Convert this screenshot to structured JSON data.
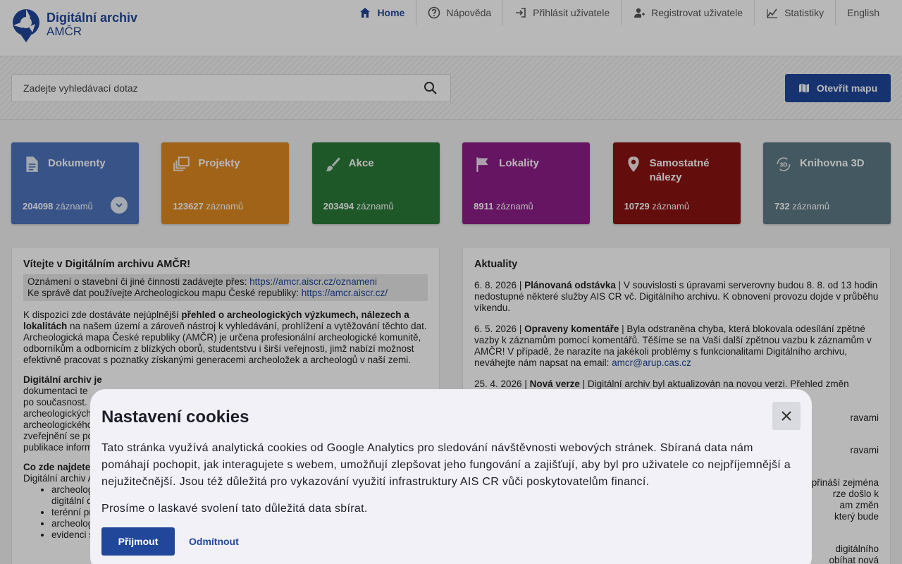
{
  "header": {
    "logo_title": "Digitální archiv",
    "logo_sub": "AMČR",
    "nav": [
      {
        "label": "Home",
        "icon": "home-icon"
      },
      {
        "label": "Nápověda",
        "icon": "help-icon"
      },
      {
        "label": "Přihlásit uživatele",
        "icon": "login-icon"
      },
      {
        "label": "Registrovat uživatele",
        "icon": "register-icon"
      },
      {
        "label": "Statistiky",
        "icon": "stats-icon"
      },
      {
        "label": "English",
        "icon": ""
      }
    ]
  },
  "search": {
    "placeholder": "Zadejte vyhledávací dotaz",
    "map_button": "Otevřít mapu"
  },
  "tiles": [
    {
      "title": "Dokumenty",
      "count": "204098",
      "unit": "záznamů",
      "color": "#4d74bd",
      "icon": "document-icon"
    },
    {
      "title": "Projekty",
      "count": "123627",
      "unit": "záznamů",
      "color": "#e08a22",
      "icon": "projects-icon"
    },
    {
      "title": "Akce",
      "count": "203494",
      "unit": "záznamů",
      "color": "#2a7a39",
      "icon": "brush-icon"
    },
    {
      "title": "Lokality",
      "count": "8911",
      "unit": "záznamů",
      "color": "#8e1e8a",
      "icon": "flag-icon"
    },
    {
      "title": "Samostatné nálezy",
      "count": "10729",
      "unit": "záznamů",
      "color": "#8a1212",
      "icon": "pin-icon"
    },
    {
      "title": "Knihovna 3D",
      "count": "732",
      "unit": "záznamů",
      "color": "#5d7a85",
      "icon": "3d-icon"
    }
  ],
  "welcome": {
    "title": "Vítejte v Digitálním archivu AMČR!",
    "notice_1": "Oznámení o stavební či jiné činnosti zadávejte přes: ",
    "notice_1_link": "https://amcr.aiscr.cz/oznameni",
    "notice_2": "Ke správě dat používejte Archeologickou mapu České republiky: ",
    "notice_2_link": "https://amcr.aiscr.cz/",
    "p1_a": "K dispozici zde dostáváte nejúplnější ",
    "p1_bold": "přehled o archeologických výzkumech, nálezech a lokalitách",
    "p1_b": " na našem území a zároveň nástroj k vyhledávání, prohlížení a vytěžování těchto dat. Archeologická mapa České republiky (AMČR) je určena profesionální archeologické komunitě, odborníkům a odbornicím z blízkých oborů, studentstvu i širší veřejnosti, jimž nabízí možnost efektivně pracovat s poznatky získanými generacemi archeoložek a archeologů v naší zemi.",
    "p2_bold": "Digitální archiv je",
    "p2_lines": [
      "dokumentaci te",
      "po současnost.",
      "archeologických",
      "archeologického",
      "zveřejnění se po",
      "publikace inform"
    ],
    "p3_bold": "Co zde najdete",
    "p3_line": "Digitální archiv A",
    "bullets": [
      "archeolog",
      "digitální d",
      "terénní pr",
      "archeolog",
      "evidenci s"
    ]
  },
  "news": {
    "title": "Aktuality",
    "items": [
      {
        "date": "6. 8. 2026",
        "headline": "Plánovaná odstávka",
        "text": "V souvislosti s úpravami serverovny budou 8. 8. od 13 hodin nedostupné některé služby AIS CR vč. Digitálního archivu. K obnovení provozu dojde v průběhu víkendu."
      },
      {
        "date": "6. 5. 2026",
        "headline": "Opraveny komentáře",
        "text": "Byla odstraněna chyba, která blokovala odesílání zpětné vazby k záznamům pomocí komentářů. Těšíme se na Vaši další zpětnou vazbu k záznamům v AMČR! V případě, že narazíte na jakékoli problémy s funkcionalitami Digitálního archivu, neváhejte nám napsat na email: ",
        "email": "amcr@arup.cas.cz"
      },
      {
        "date": "25. 4. 2026",
        "headline": "Nová verze",
        "text": "Digitální archiv byl aktualizován na novou verzi. Přehled změn"
      }
    ],
    "tail_fragments": [
      "ravami",
      "ravami",
      "přináší zejména",
      "rze došlo k",
      "am změn",
      "který bude",
      "digitálního",
      "obíhat nová"
    ]
  },
  "cookies": {
    "title": "Nastavení cookies",
    "text_1": "Tato stránka využívá analytická cookies od Google Analytics pro sledování návštěvnosti webových stránek. Sbíraná data nám pomáhají pochopit, jak interagujete s webem, umožňují zlepšovat jeho fungování a zajišťují, aby byl pro uživatele co nejpříjemnější a nejužitečnější. Jsou též důležitá pro vykazování využití infrastruktury AIS CR vůči poskytovatelům financí.",
    "text_2": "Prosíme o laskavé svolení tato důležitá data sbírat.",
    "accept": "Přijmout",
    "decline": "Odmítnout"
  }
}
